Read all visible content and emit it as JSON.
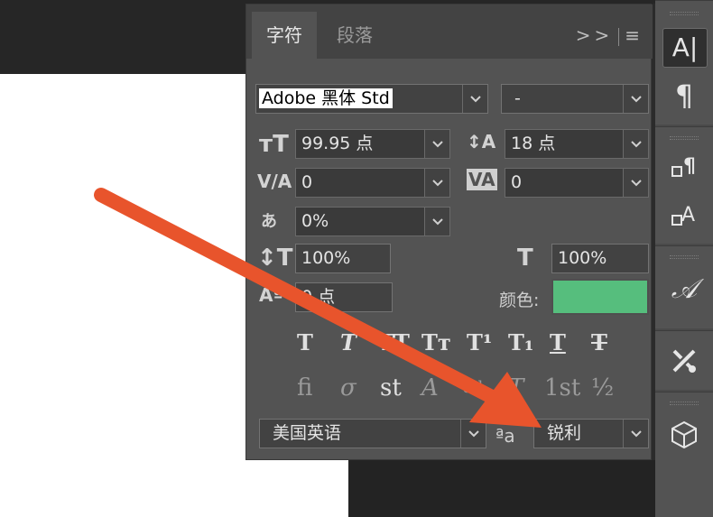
{
  "tabs": {
    "character": "字符",
    "paragraph": "段落"
  },
  "panel_menu": {
    "expand": ">>",
    "menu": "≡"
  },
  "font": {
    "family": "Adobe 黑体 Std",
    "style": "-"
  },
  "size": {
    "font_size": "99.95 点",
    "leading": "18 点"
  },
  "spacing": {
    "kerning": "0",
    "tracking": "0",
    "tsume": "0%"
  },
  "scale": {
    "vertical": "100%",
    "horizontal": "100%"
  },
  "baseline": {
    "shift": "0 点"
  },
  "color": {
    "label": "颜色:",
    "value": "#56be7d"
  },
  "bottom": {
    "language": "美国英语",
    "aa_label": "ªa",
    "antialias": "锐利"
  },
  "style_buttons": [
    "T",
    "T",
    "TT",
    "Tт",
    "T¹",
    "T₁",
    "T",
    "T"
  ],
  "opentype_buttons": [
    "fi",
    "σ",
    "st",
    "A",
    "ad",
    "T",
    "1st",
    "½"
  ],
  "strip_icons": [
    "character-icon",
    "paragraph-icon",
    "paragraph-styles-icon",
    "character-styles-icon",
    "glyphs-icon",
    "tools-icon",
    "3d-icon"
  ],
  "strip_glyphs": {
    "character": "A|",
    "paragraph": "¶",
    "glyphs": "𝒜"
  }
}
